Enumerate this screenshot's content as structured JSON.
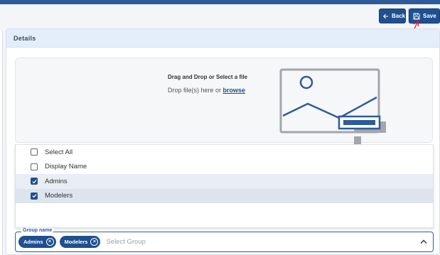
{
  "toolbar": {
    "back_label": "Back",
    "save_label": "Save"
  },
  "details": {
    "title": "Details"
  },
  "dropzone": {
    "title": "Drag and Drop or Select a file",
    "subtitle_prefix": "Drop file(s) here or",
    "browse_label": "browse"
  },
  "options": [
    {
      "label": "Select All",
      "checked": false
    },
    {
      "label": "Display Name",
      "checked": false
    },
    {
      "label": "Admins",
      "checked": true
    },
    {
      "label": "Modelers",
      "checked": true
    }
  ],
  "group_field": {
    "label": "Group name",
    "chips": [
      "Admins",
      "Modelers"
    ],
    "placeholder": "Select Group"
  },
  "colors": {
    "accent": "#1f4f8f",
    "annotation_arrow": "#e0201a"
  }
}
